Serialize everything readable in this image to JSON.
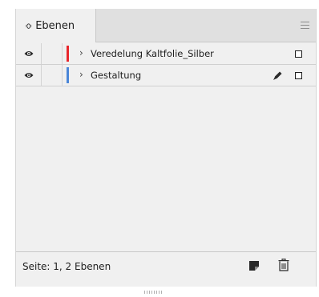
{
  "panel": {
    "tab_label": "Ebenen",
    "tab_collapse_glyph": "≎",
    "menu_icon": "panel-menu-icon"
  },
  "layers": [
    {
      "name": "Veredelung Kaltfolie_Silber",
      "color": "#e8262b",
      "visible": true,
      "expand_glyph": "›",
      "has_pen": false
    },
    {
      "name": "Gestaltung",
      "color": "#4a86d8",
      "visible": true,
      "expand_glyph": "›",
      "has_pen": true
    }
  ],
  "footer": {
    "status": "Seite: 1, 2 Ebenen",
    "new_layer_icon": "new-layer-icon",
    "delete_icon": "trash-icon"
  }
}
